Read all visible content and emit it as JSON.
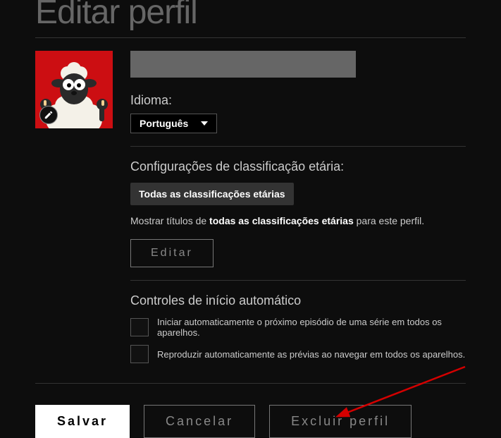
{
  "page_title": "Editar perfil",
  "profile_name": "",
  "language": {
    "label": "Idioma:",
    "value": "Português"
  },
  "maturity": {
    "title": "Configurações de classificação etária:",
    "chip": "Todas as classificações etárias",
    "helper_pre": "Mostrar títulos de ",
    "helper_bold": "todas as classificações etárias",
    "helper_post": " para este perfil.",
    "edit_label": "Editar"
  },
  "autoplay": {
    "title": "Controles de início automático",
    "cb1_label": "Iniciar automaticamente o próximo episódio de uma série em todos os aparelhos.",
    "cb2_label": "Reproduzir automaticamente as prévias ao navegar em todos os aparelhos."
  },
  "footer": {
    "save": "Salvar",
    "cancel": "Cancelar",
    "delete": "Excluir perfil"
  }
}
